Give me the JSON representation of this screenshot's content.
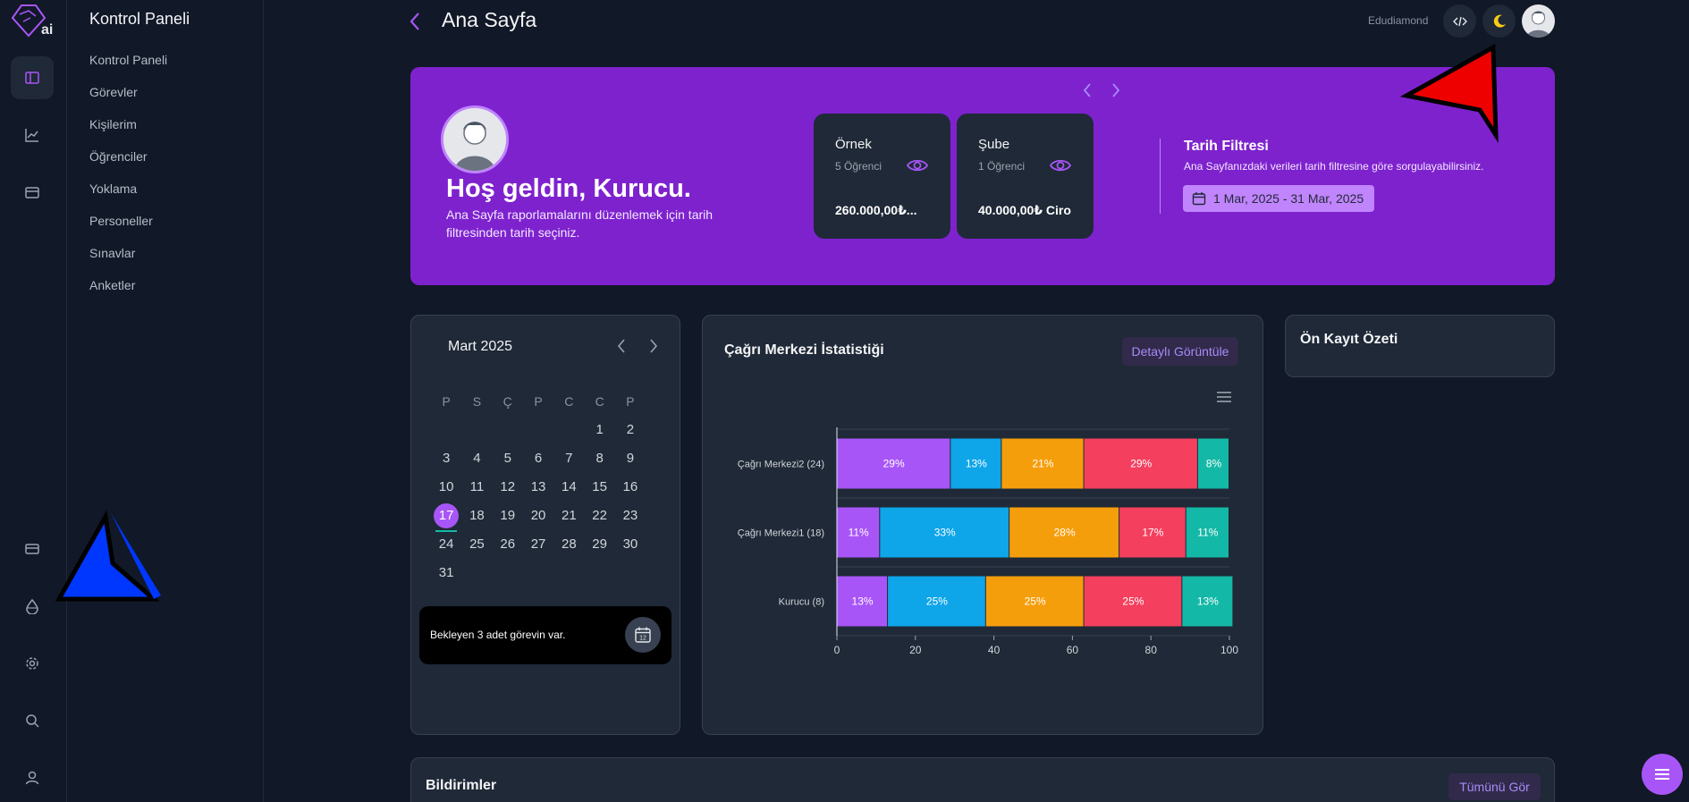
{
  "sidebar": {
    "title": "Kontrol Paneli",
    "items": [
      "Kontrol Paneli",
      "Görevler",
      "Kişilerim",
      "Öğrenciler",
      "Yoklama",
      "Personeller",
      "Sınavlar",
      "Anketler"
    ]
  },
  "header": {
    "title": "Ana Sayfa",
    "brand": "Edudiamond"
  },
  "hero": {
    "welcome": "Hoş geldin, Kurucu.",
    "subtitle": "Ana Sayfa raporlamalarını düzenlemek için tarih filtresinden tarih seçiniz.",
    "cards": [
      {
        "name": "Örnek",
        "count": "5 Öğrenci",
        "value": "260.000,00₺..."
      },
      {
        "name": "Şube",
        "count": "1 Öğrenci",
        "value": "40.000,00₺ Ciro"
      }
    ],
    "date_filter": {
      "title": "Tarih Filtresi",
      "subtitle": "Ana Sayfanızdaki verileri tarih filtresine göre sorgulayabilirsiniz.",
      "range": "1 Mar, 2025 - 31 Mar, 2025"
    }
  },
  "calendar": {
    "title": "Mart 2025",
    "weekdays": [
      "P",
      "S",
      "Ç",
      "P",
      "C",
      "C",
      "P"
    ],
    "weeks": [
      [
        "",
        "",
        "",
        "",
        "",
        "1",
        "2"
      ],
      [
        "3",
        "4",
        "5",
        "6",
        "7",
        "8",
        "9"
      ],
      [
        "10",
        "11",
        "12",
        "13",
        "14",
        "15",
        "16"
      ],
      [
        "17",
        "18",
        "19",
        "20",
        "21",
        "22",
        "23"
      ],
      [
        "24",
        "25",
        "26",
        "27",
        "28",
        "29",
        "30"
      ],
      [
        "31",
        "",
        "",
        "",
        "",
        "",
        ""
      ]
    ],
    "today": "17",
    "task_text": "Bekleyen 3 adet görevin var.",
    "task_icon_day": "12"
  },
  "call_center": {
    "title": "Çağrı Merkezi İstatistiği",
    "detail_button": "Detaylı Görüntüle"
  },
  "chart_data": {
    "type": "bar",
    "orientation": "horizontal",
    "stacked": true,
    "categories": [
      "Çağrı Merkezi2 (24)",
      "Çağrı Merkezi1 (18)",
      "Kurucu (8)"
    ],
    "series": [
      {
        "values": [
          29,
          11,
          13
        ],
        "color": "#a855f7"
      },
      {
        "values": [
          13,
          33,
          25
        ],
        "color": "#0ea5e9"
      },
      {
        "values": [
          21,
          28,
          25
        ],
        "color": "#f59e0b"
      },
      {
        "values": [
          29,
          17,
          25
        ],
        "color": "#f43f5e"
      },
      {
        "values": [
          8,
          11,
          13
        ],
        "color": "#14b8a6"
      }
    ],
    "xlim": [
      0,
      100
    ],
    "xticks": [
      "0",
      "20",
      "40",
      "60",
      "80",
      "100"
    ]
  },
  "pre_register": {
    "title": "Ön Kayıt Özeti"
  },
  "notifications": {
    "title": "Bildirimler",
    "all_button": "Tümünü Gör"
  },
  "colors": {
    "accent": "#a855f7",
    "hero": "#7e22ce",
    "panel": "#1f2937",
    "background": "#111827"
  }
}
